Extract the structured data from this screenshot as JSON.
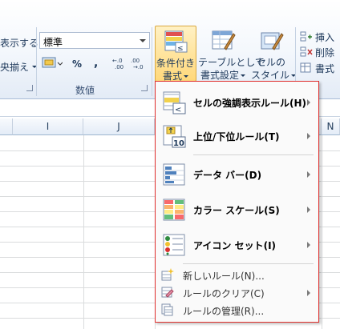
{
  "ribbon": {
    "left_clip_top": "表示する",
    "left_clip_mid": "央揃え",
    "number_format": "標準",
    "currency_symbol": "%",
    "comma_symbol": ",",
    "group_number_label": "数値",
    "cf_button_line1": "条件付き",
    "cf_button_line2": "書式",
    "table_button_line1": "テーブルとして",
    "table_button_line2": "書式設定",
    "cell_style_line1": "セルの",
    "cell_style_line2": "スタイル",
    "insert_label": "挿入",
    "delete_label": "削除",
    "format_label": "書式"
  },
  "sheet": {
    "columns": [
      "I",
      "J",
      "N"
    ]
  },
  "menu": {
    "items": [
      {
        "label": "セルの強調表示ルール(H)",
        "icon": "highlight-cells-rules-icon",
        "submenu": true
      },
      {
        "label": "上位/下位ルール(T)",
        "icon": "top-bottom-rules-icon",
        "submenu": true
      },
      {
        "label": "データ バー(D)",
        "icon": "data-bars-icon",
        "submenu": true
      },
      {
        "label": "カラー スケール(S)",
        "icon": "color-scales-icon",
        "submenu": true
      },
      {
        "label": "アイコン セット(I)",
        "icon": "icon-sets-icon",
        "submenu": true
      }
    ],
    "small_items": [
      {
        "label": "新しいルール(N)...",
        "icon": "new-rule-icon",
        "submenu": false
      },
      {
        "label": "ルールのクリア(C)",
        "icon": "clear-rules-icon",
        "submenu": true
      },
      {
        "label": "ルールの管理(R)...",
        "icon": "manage-rules-icon",
        "submenu": false
      }
    ]
  }
}
